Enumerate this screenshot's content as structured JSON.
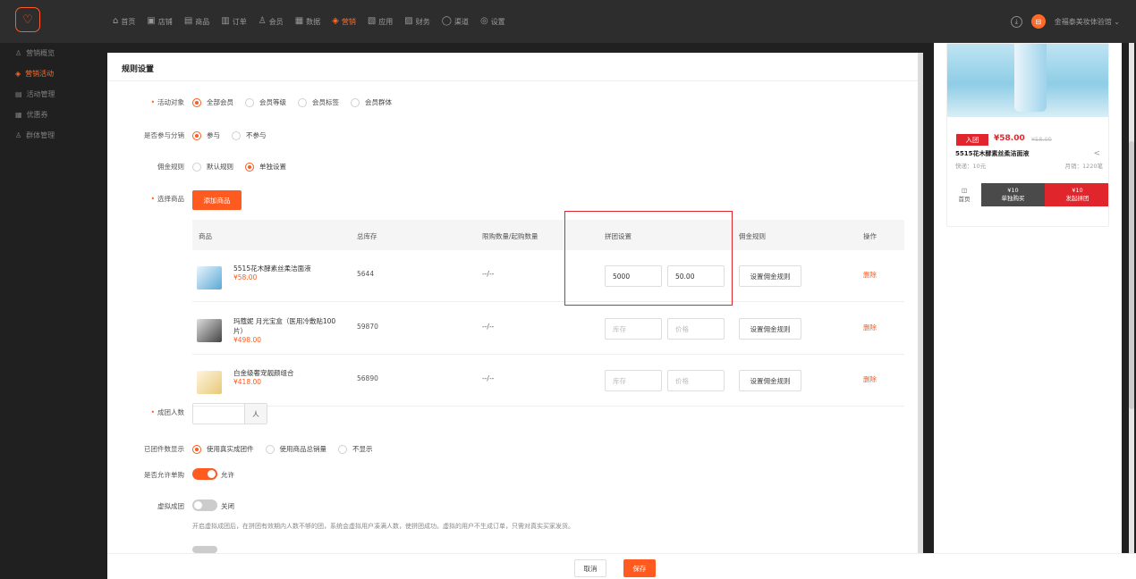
{
  "topbar": {
    "logo": "♡",
    "nav": [
      {
        "icon": "⌂",
        "label": "首页",
        "active": false
      },
      {
        "icon": "▣",
        "label": "店铺",
        "active": false
      },
      {
        "icon": "▤",
        "label": "商品",
        "active": false
      },
      {
        "icon": "▥",
        "label": "订单",
        "active": false
      },
      {
        "icon": "♙",
        "label": "会员",
        "active": false
      },
      {
        "icon": "▦",
        "label": "数据",
        "active": false
      },
      {
        "icon": "◈",
        "label": "营销",
        "active": true
      },
      {
        "icon": "▧",
        "label": "应用",
        "active": false
      },
      {
        "icon": "▨",
        "label": "财务",
        "active": false
      },
      {
        "icon": "◯",
        "label": "渠道",
        "active": false
      },
      {
        "icon": "◎",
        "label": "设置",
        "active": false
      }
    ],
    "download_icon": "⤓",
    "avatar": "⊟",
    "user": "金福泰美妆体验馆 ⌄"
  },
  "sidebar": {
    "items": [
      {
        "icon": "♙",
        "label": "营销概览",
        "active": false
      },
      {
        "icon": "◈",
        "label": "营销活动",
        "active": true
      },
      {
        "icon": "▤",
        "label": "活动管理",
        "active": false
      },
      {
        "icon": "▦",
        "label": "优惠券",
        "active": false
      },
      {
        "icon": "♙",
        "label": "群体管理",
        "active": false
      }
    ]
  },
  "form": {
    "title": "规则设置",
    "target": {
      "label": "活动对象",
      "options": [
        "全部会员",
        "会员等级",
        "会员标签",
        "会员群体"
      ],
      "selected": 0
    },
    "distribution": {
      "label": "是否参与分销",
      "options": [
        "参与",
        "不参与"
      ],
      "selected": 0
    },
    "commission_rule": {
      "label": "佣金规则",
      "options": [
        "默认规则",
        "单独设置"
      ],
      "selected": 1
    },
    "select_goods": {
      "label": "选择商品",
      "button": "添加商品"
    },
    "table": {
      "headers": [
        "商品",
        "总库存",
        "限购数量/起购数量",
        "拼团设置",
        "佣金规则",
        "操作"
      ],
      "rows": [
        {
          "name": "5515花木酵素丝柔洁面液",
          "price": "¥58.00",
          "stock": "5644",
          "limit": "--/--",
          "group_stock": "5000",
          "group_price": "50.00",
          "stock_ph": false,
          "commission": "设置佣金规则",
          "action": "删除"
        },
        {
          "name": "玛蔻妮 月光宝盒（医用冷敷贴100片）",
          "price": "¥498.00",
          "stock": "59870",
          "limit": "--/--",
          "group_stock": "库存",
          "group_price": "价格",
          "stock_ph": true,
          "commission": "设置佣金规则",
          "action": "删除"
        },
        {
          "name": "白金级奢宠靓颜组合",
          "price": "¥418.00",
          "stock": "56890",
          "limit": "--/--",
          "group_stock": "库存",
          "group_price": "价格",
          "stock_ph": true,
          "commission": "设置佣金规则",
          "action": "删除"
        }
      ]
    },
    "group_size": {
      "label": "成团人数",
      "unit": "人"
    },
    "group_display": {
      "label": "已团件数显示",
      "options": [
        "使用真实成团件",
        "使用商品总销量",
        "不显示"
      ],
      "selected": 0
    },
    "allow_single": {
      "label": "是否允许单购",
      "state": "允许"
    },
    "virtual_group": {
      "label": "虚拟成团",
      "state": "关闭",
      "hint": "开启虚拟成团后，在拼团有效期内人数不够的团，系统会虚拟用户凑满人数，使拼团成功。虚拟的用户不生成订单，只需对真实买家发货。"
    }
  },
  "footer": {
    "cancel": "取消",
    "save": "保存"
  },
  "preview": {
    "tag": "入团",
    "price": "¥58.00",
    "orig_price": "¥58.00",
    "name": "5515花木酵素丝柔洁面液",
    "shipping": "快递：10元",
    "sold": "月销：1220笔",
    "share_icon": "<",
    "home_icon": "◫",
    "home": "首页",
    "single_price": "¥10",
    "single_label": "单独购买",
    "group_price": "¥10",
    "group_label": "发起拼团"
  },
  "colors": {
    "accent": "#ff5a1f",
    "highlight": "#e0262c"
  }
}
